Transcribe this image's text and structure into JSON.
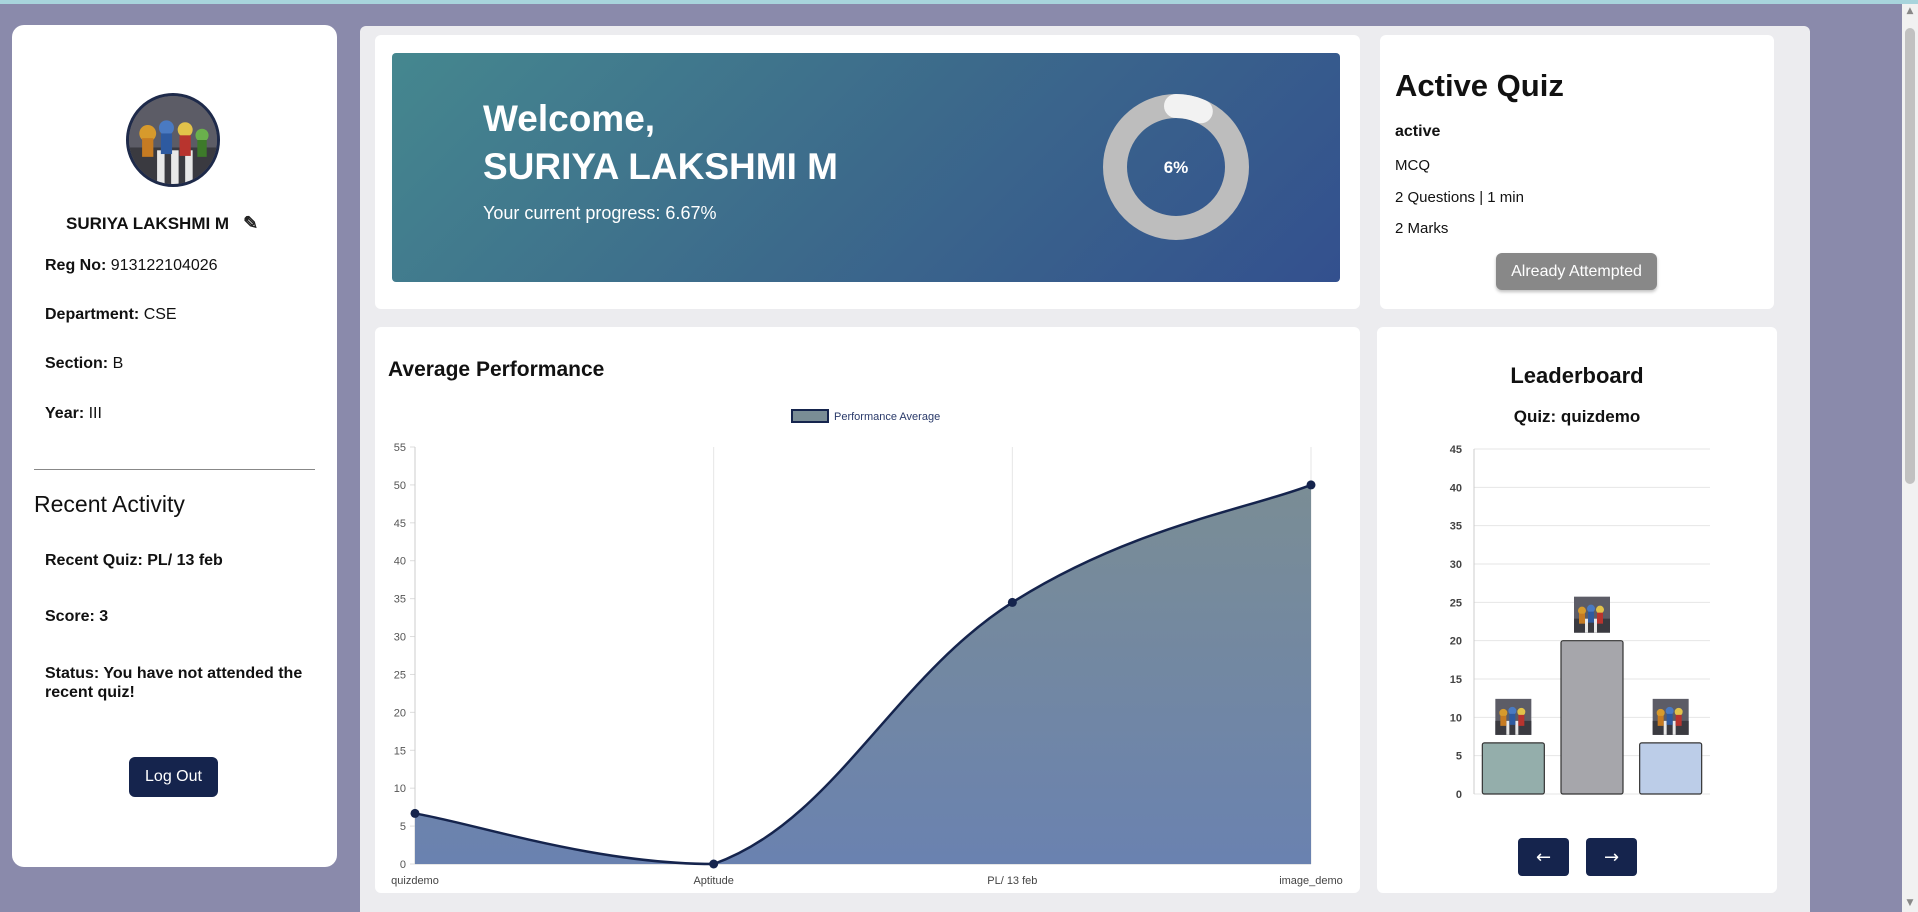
{
  "profile": {
    "name": "SURIYA LAKSHMI M",
    "reg_label": "Reg No:",
    "reg_value": "913122104026",
    "dept_label": "Department:",
    "dept_value": "CSE",
    "section_label": "Section:",
    "section_value": "B",
    "year_label": "Year:",
    "year_value": "III",
    "edit_icon": "pencil-icon"
  },
  "recent_activity": {
    "title": "Recent Activity",
    "quiz_label": "Recent Quiz:",
    "quiz_value": "PL/ 13 feb",
    "score_label": "Score:",
    "score_value": "3",
    "status_label": "Status:",
    "status_value": "You have not attended the recent quiz!"
  },
  "logout_label": "Log Out",
  "welcome": {
    "greeting": "Welcome,",
    "name": "SURIYA LAKSHMI M",
    "progress_text": "Your current progress: 6.67%",
    "donut_label": "6%",
    "progress_fraction": 0.0667
  },
  "active_quiz": {
    "title": "Active Quiz",
    "status": "active",
    "type": "MCQ",
    "details": "2 Questions | 1 min",
    "marks": "2 Marks",
    "button_label": "Already Attempted"
  },
  "performance": {
    "title": "Average Performance"
  },
  "leaderboard": {
    "title": "Leaderboard",
    "subtitle": "Quiz: quizdemo",
    "prev_label": "←",
    "next_label": "→"
  },
  "chart_data": [
    {
      "type": "area",
      "title": "Average Performance",
      "legend": [
        "Performance Average"
      ],
      "legend_position": "top-center",
      "categories": [
        "quizdemo",
        "Aptitude",
        "PL/ 13 feb",
        "image_demo"
      ],
      "series": [
        {
          "name": "Performance Average",
          "values": [
            6.67,
            0,
            34.5,
            50
          ]
        }
      ],
      "ylim": [
        0,
        55
      ],
      "yticks": [
        0,
        5,
        10,
        15,
        20,
        25,
        30,
        35,
        40,
        45,
        50,
        55
      ],
      "grid": true,
      "colors": {
        "line": "#15244d",
        "fill_top": "#7a8d95",
        "fill_bottom": "#6a82b0"
      }
    },
    {
      "type": "bar",
      "title": "Quiz: quizdemo",
      "categories": [
        "",
        "",
        ""
      ],
      "values": [
        6.67,
        20,
        6.67
      ],
      "ylim": [
        0,
        45
      ],
      "yticks": [
        0,
        5,
        10,
        15,
        20,
        25,
        30,
        35,
        40,
        45
      ],
      "grid": true,
      "colors": [
        "#94aeab",
        "#a6a6ab",
        "#bccde8"
      ]
    }
  ]
}
